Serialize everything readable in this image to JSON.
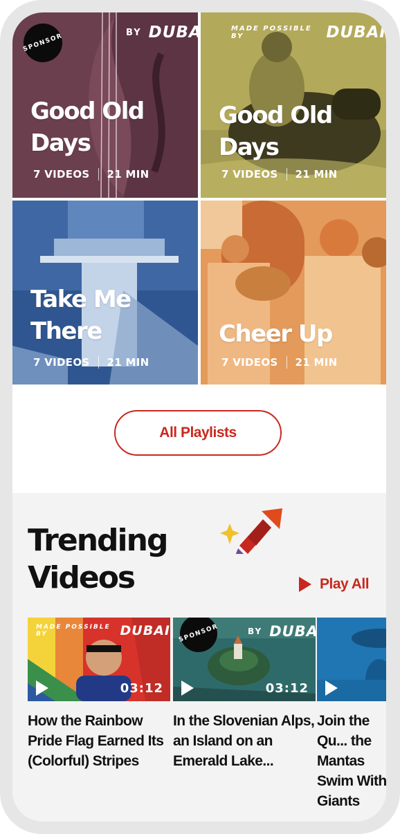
{
  "playlists": [
    {
      "title_line1": "Good Old",
      "title_line2": "Days",
      "videos": "7 VIDEOS",
      "duration": "21 MIN",
      "badge": "SPONSOR",
      "brand_prefix": "BY",
      "brand_name": "DUBAI"
    },
    {
      "title_line1": "Good Old",
      "title_line2": "Days",
      "videos": "7 VIDEOS",
      "duration": "21 MIN",
      "brand_prefix": "MADE POSSIBLE BY",
      "brand_name": "DUBAI"
    },
    {
      "title_line1": "Take Me",
      "title_line2": "There",
      "videos": "7 VIDEOS",
      "duration": "21 MIN"
    },
    {
      "title_line1": "Cheer Up",
      "videos": "7 VIDEOS",
      "duration": "21 MIN"
    }
  ],
  "all_playlists_label": "All Playlists",
  "trending": {
    "title_line1": "Trending",
    "title_line2": "Videos",
    "play_all_label": "Play All",
    "videos": [
      {
        "title": "How the Rainbow Pride Flag Earned Its (Colorful) Stripes",
        "duration": "03:12",
        "brand_prefix": "MADE POSSIBLE BY",
        "brand_name": "DUBAI"
      },
      {
        "title": "In the Slovenian Alps, an Island on an Emerald Lake...",
        "duration": "03:12",
        "badge": "SPONSOR",
        "brand_prefix": "BY",
        "brand_name": "DUBAI"
      },
      {
        "title": "Join the Qu... the Mantas Swim With Giants"
      }
    ]
  },
  "colors": {
    "accent": "#c8281e",
    "trending_bg": "#f3f3f3"
  }
}
